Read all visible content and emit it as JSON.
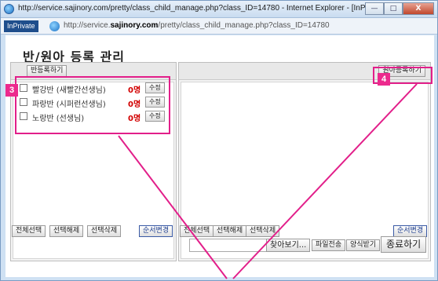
{
  "window": {
    "title": "http://service.sajinory.com/pretty/class_child_manage.php?class_ID=14780 - Internet Explorer - [InPrivate]",
    "inprivate_badge": "InPrivate",
    "address_prefix": "http://service.",
    "address_domain": "sajinory.com",
    "address_suffix": "/pretty/class_child_manage.php?class_ID=14780",
    "btn_min": "—",
    "btn_max": "□",
    "btn_close": "X"
  },
  "page": {
    "title": "반/원아 등록 관리"
  },
  "left_panel": {
    "register_class_button": "반등록하기",
    "classes": [
      {
        "name": "빨강반 (새빨간선생님)",
        "count": "0명",
        "edit": "수정"
      },
      {
        "name": "파랑반 (시퍼런선생님)",
        "count": "0명",
        "edit": "수정"
      },
      {
        "name": "노랑반 (선생님)",
        "count": "0명",
        "edit": "수정"
      }
    ],
    "select_all": "전체선택",
    "deselect": "선택해제",
    "delete_selected": "선택삭제",
    "reorder": "순서변경"
  },
  "right_panel": {
    "register_child_button": "원아등록하기",
    "select_all": "전체선택",
    "deselect": "선택해제",
    "delete_selected": "선택삭제",
    "reorder": "순서변경"
  },
  "footer": {
    "browse": "찾아보기...",
    "file_transfer": "파일전송",
    "form_download": "양식받기",
    "close": "종료하기"
  },
  "annotations": {
    "box3_number": "3",
    "box4_number": "4",
    "highlight_color": "#e21f8a"
  }
}
